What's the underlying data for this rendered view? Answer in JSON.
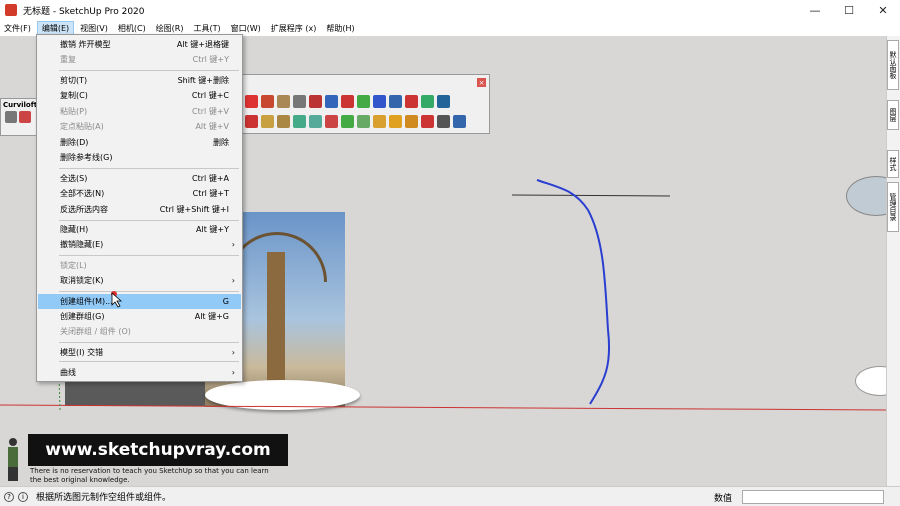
{
  "window": {
    "title": "无标题 - SketchUp Pro 2020",
    "minimize": "—",
    "maximize": "☐",
    "close": "✕"
  },
  "menubar": [
    "文件(F)",
    "编辑(E)",
    "视图(V)",
    "相机(C)",
    "绘图(R)",
    "工具(T)",
    "窗口(W)",
    "扩展程序 (x)",
    "帮助(H)"
  ],
  "curviloft": {
    "title": "Curviloft"
  },
  "edit_menu": {
    "items": [
      {
        "label": "撤销 炸开模型",
        "shortcut": "Alt 键+退格键"
      },
      {
        "label": "重复",
        "shortcut": "Ctrl 键+Y"
      },
      {
        "label": "剪切(T)",
        "shortcut": "Shift 键+删除"
      },
      {
        "label": "复制(C)",
        "shortcut": "Ctrl 键+C"
      },
      {
        "label": "粘贴(P)",
        "shortcut": "Ctrl 键+V"
      },
      {
        "label": "定点粘贴(A)",
        "shortcut": "Alt 键+V"
      },
      {
        "label": "删除(D)",
        "shortcut": "删除"
      },
      {
        "label": "删除参考线(G)",
        "shortcut": ""
      },
      {
        "label": "全选(S)",
        "shortcut": "Ctrl 键+A"
      },
      {
        "label": "全部不选(N)",
        "shortcut": "Ctrl 键+T"
      },
      {
        "label": "反选所选内容",
        "shortcut": "Ctrl 键+Shift 键+I"
      },
      {
        "label": "隐藏(H)",
        "shortcut": "Alt 键+Y"
      },
      {
        "label": "撤销隐藏(E)",
        "shortcut": ""
      },
      {
        "label": "锁定(L)",
        "shortcut": ""
      },
      {
        "label": "取消锁定(K)",
        "shortcut": ""
      },
      {
        "label": "创建组件(M)...",
        "shortcut": "G"
      },
      {
        "label": "创建群组(G)",
        "shortcut": "Alt 键+G"
      },
      {
        "label": "关闭群组 / 组件 (O)",
        "shortcut": ""
      },
      {
        "label": "模型(I) 交错",
        "shortcut": ""
      },
      {
        "label": "曲线",
        "shortcut": ""
      }
    ]
  },
  "right_tray": {
    "tabs": [
      "默认面板",
      "图层",
      "样式",
      "管理目录"
    ]
  },
  "banner": {
    "url": "www.sketchupvray.com",
    "subtitle_line1": "There is no reservation to teach you SketchUp so that you can learn",
    "subtitle_line2": "the best original knowledge."
  },
  "statusbar": {
    "hint": "根据所选图元制作空组件或组件。",
    "measurements_label": "数值",
    "measurements_value": ""
  },
  "colors": {
    "menu_highlight": "#91c9f7",
    "viewport_bg": "#d8d7d5",
    "curve_blue": "#2a3fd1",
    "axis_red": "#cc3333"
  }
}
